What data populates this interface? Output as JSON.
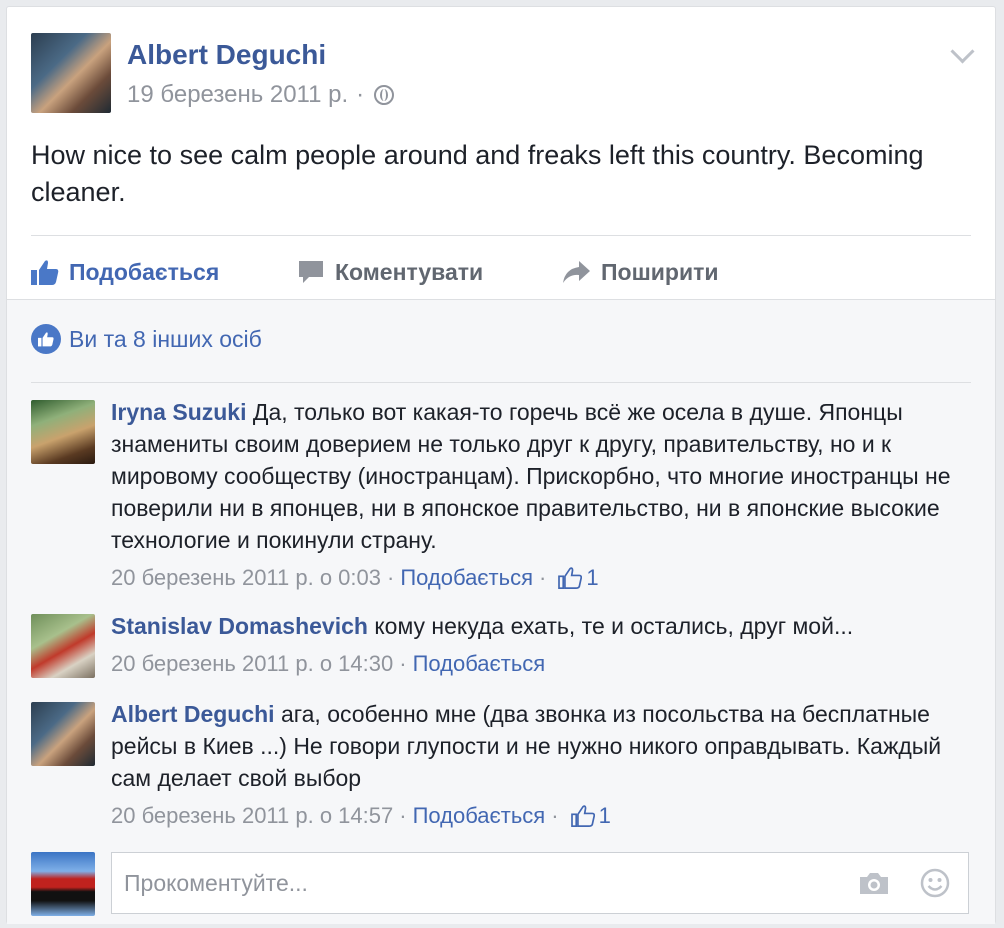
{
  "post": {
    "author": "Albert Deguchi",
    "date": "19 березень 2011 р.",
    "separator": "·",
    "text": "How nice to see calm people around and freaks left this country. Becoming cleaner."
  },
  "actions": {
    "like": "Подобається",
    "comment": "Коментувати",
    "share": "Поширити"
  },
  "likes_summary": "Ви та 8 інших осіб",
  "comments": [
    {
      "author": "Iryna Suzuki",
      "text": "Да, только вот какая-то горечь всё же осела в душе. Японцы знамениты своим доверием не только друг к другу, правительству, но и к мировому сообществу (иностранцам). Прискорбно, что многие иностранцы не поверили ни в японцев, ни в японское правительство, ни в японские высокие технологие и покинули страну.",
      "timestamp": "20 березень 2011 р. о 0:03",
      "like_label": "Подобається",
      "likes": "1"
    },
    {
      "author": "Stanislav Domashevich",
      "text": "кому некуда ехать, те и остались, друг мой...",
      "timestamp": "20 березень 2011 р. о 14:30",
      "like_label": "Подобається",
      "likes": ""
    },
    {
      "author": "Albert Deguchi",
      "text": "ага, особенно мне (два звонка из посольства на бесплатные рейсы в Киев ...) Не говори глупости и не нужно никого оправдывать. Каждый сам делает свой выбор",
      "timestamp": "20 березень 2011 р. о 14:57",
      "like_label": "Подобається",
      "likes": "1"
    }
  ],
  "compose": {
    "placeholder": "Прокоментуйте..."
  },
  "colors": {
    "link": "#3b5998",
    "accent": "#4267b2",
    "meta": "#90949c"
  }
}
